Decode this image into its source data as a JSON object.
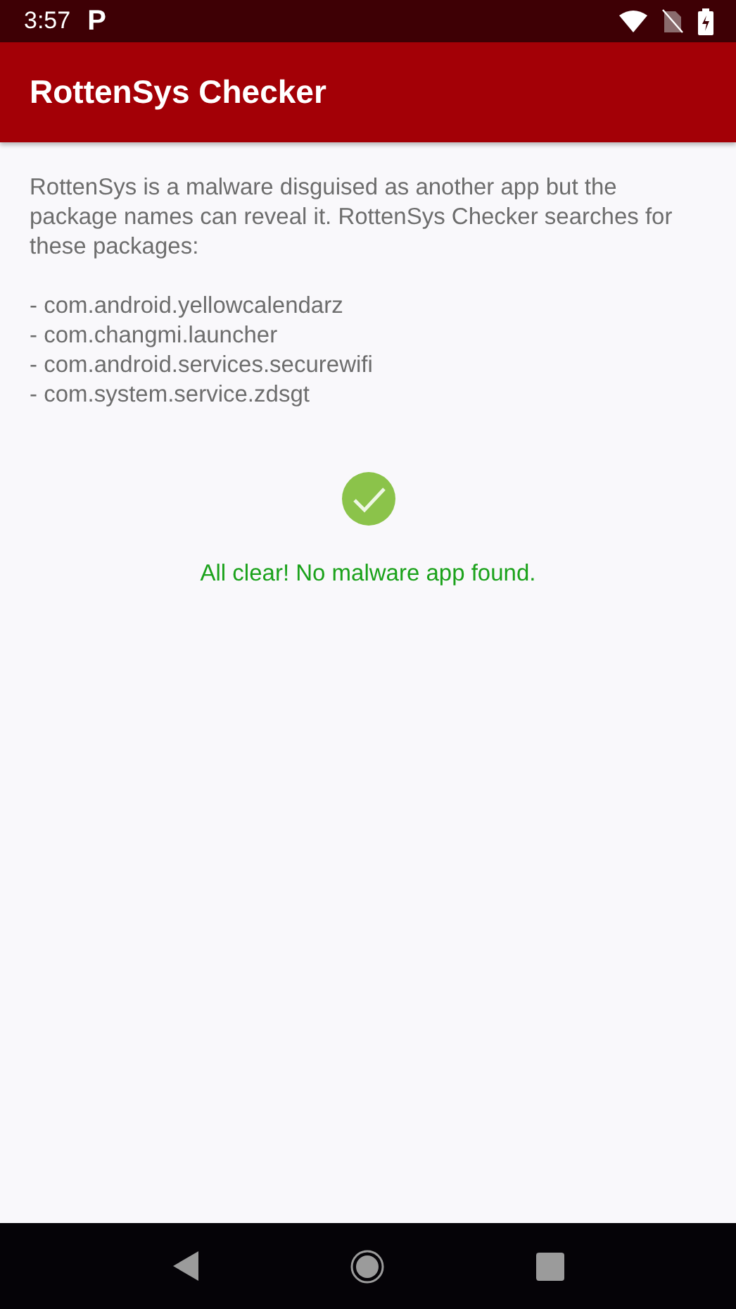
{
  "status_bar": {
    "time": "3:57",
    "notification": "P"
  },
  "app_bar": {
    "title": "RottenSys Checker"
  },
  "description": "RottenSys is a malware disguised as another app but the package names can reveal it. RottenSys Checker searches for these packages:",
  "packages": [
    "- com.android.yellowcalendarz",
    "- com.changmi.launcher",
    "- com.android.services.securewifi",
    "- com.system.service.zdsgt"
  ],
  "result": {
    "kind": "clear",
    "message": "All clear! No malware app found."
  }
}
